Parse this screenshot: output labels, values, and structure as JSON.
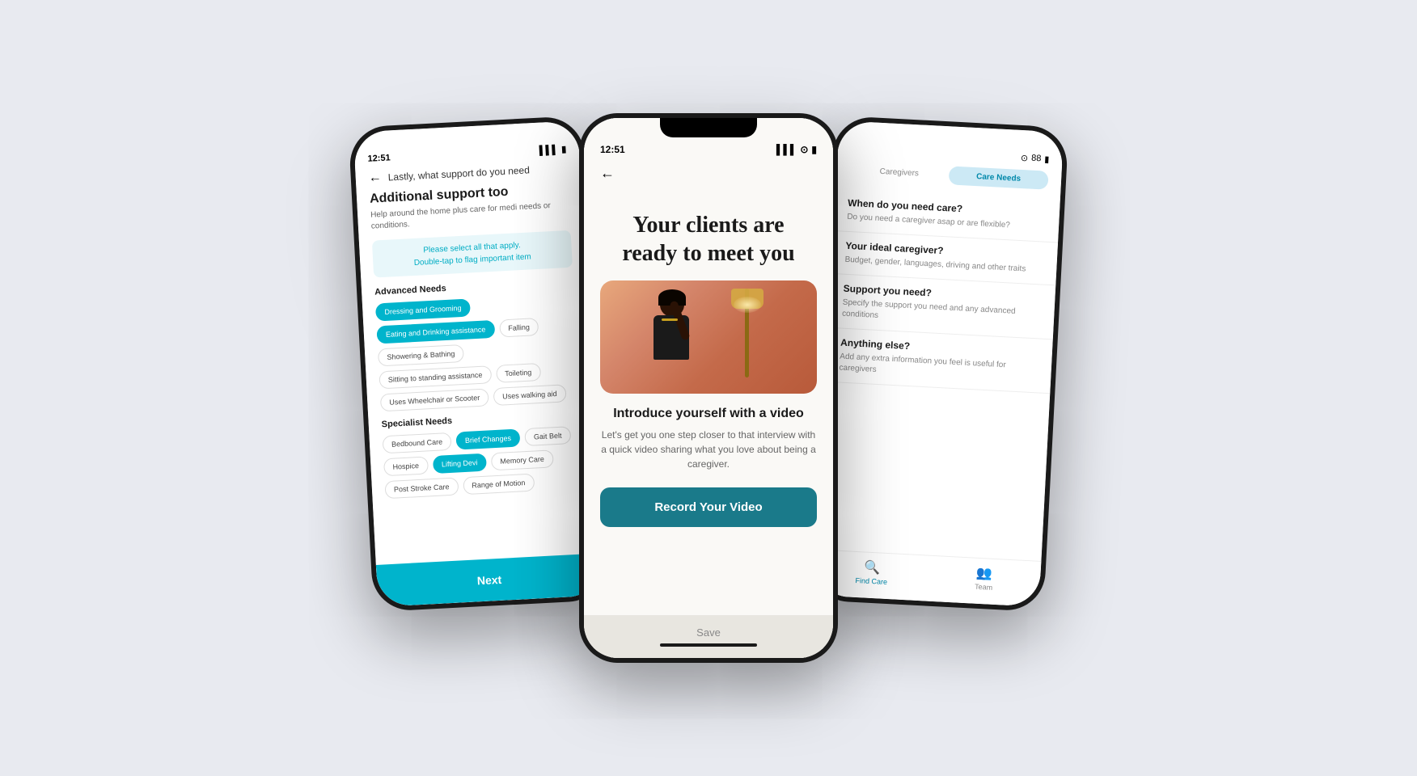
{
  "scene": {
    "background_color": "#e8eaf0"
  },
  "left_phone": {
    "status_time": "12:51",
    "header_text": "Lastly, what support do you need",
    "title": "Additional support too",
    "subtitle": "Help around the home plus care for medi needs or conditions.",
    "info_banner_line1": "Please select all that apply.",
    "info_banner_line2": "Double-tap to flag important item",
    "sections": [
      {
        "label": "Advanced Needs",
        "tags": [
          {
            "text": "Dressing and Grooming",
            "active": true
          },
          {
            "text": "Eating and Drinking assistance",
            "active": true
          },
          {
            "text": "Falling",
            "active": false
          },
          {
            "text": "Showering & Bathing",
            "active": false
          },
          {
            "text": "Sitting to standing assistance",
            "active": false
          },
          {
            "text": "Toileting",
            "active": false
          },
          {
            "text": "Uses Wheelchair or Scooter",
            "active": false
          },
          {
            "text": "Uses walking aid",
            "active": false
          }
        ]
      },
      {
        "label": "Specialist Needs",
        "tags": [
          {
            "text": "Bedbound Care",
            "active": false
          },
          {
            "text": "Brief Changes",
            "active": true
          },
          {
            "text": "Gait Belt",
            "active": false
          },
          {
            "text": "Hospice",
            "active": false
          },
          {
            "text": "Lifting Devi",
            "active": true
          },
          {
            "text": "Memory Care",
            "active": false
          },
          {
            "text": "Post Stroke Care",
            "active": false
          },
          {
            "text": "Range of Motion",
            "active": false
          }
        ]
      }
    ],
    "next_button": "Next"
  },
  "center_phone": {
    "status_time": "12:51",
    "title_line1": "Your clients are",
    "title_line2": "ready to meet you",
    "intro_title": "Introduce yourself with a video",
    "intro_body": "Let's get you one step closer to that interview with a quick video sharing what you love about being a caregiver.",
    "record_button": "Record Your Video",
    "save_label": "Save"
  },
  "right_phone": {
    "status_wifi": "wifi",
    "status_battery": "88",
    "tabs": [
      {
        "label": "Caregivers",
        "active": false
      },
      {
        "label": "Care Needs",
        "active": true
      }
    ],
    "sections": [
      {
        "title": "When do you need care?",
        "body": "Do you need a caregiver asap or are flexible?"
      },
      {
        "title": "Your ideal caregiver?",
        "body": "Budget, gender, languages, driving and other traits"
      },
      {
        "title": "Support you need?",
        "body": "Specify the support you need and any advanced conditions"
      },
      {
        "title": "Anything else?",
        "body": "Add any extra information you feel is useful for caregivers"
      }
    ],
    "nav_items": [
      {
        "label": "Find Care",
        "active": true,
        "icon": "🔍"
      },
      {
        "label": "Team",
        "active": false,
        "icon": "👥"
      }
    ]
  }
}
